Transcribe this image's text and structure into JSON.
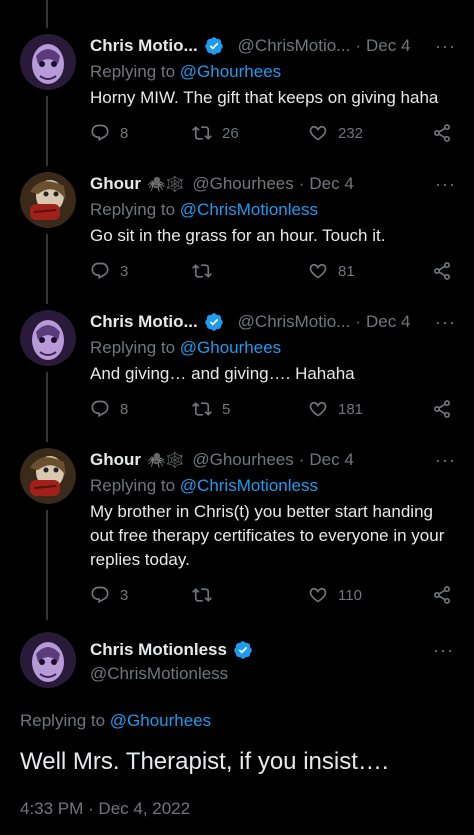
{
  "tweets": [
    {
      "name": "Chris Motio...",
      "handle": "@ChrisMotio...",
      "date": "Dec 4",
      "replying_prefix": "Replying to ",
      "replying_to": "@Ghourhees",
      "text": "Horny MIW. The gift that keeps on giving haha",
      "replies": "8",
      "retweets": "26",
      "likes": "232"
    },
    {
      "name": "Ghour",
      "handle": "@Ghourhees",
      "date": "Dec 4",
      "replying_prefix": "Replying to ",
      "replying_to": "@ChrisMotionless",
      "text": "Go sit in the grass for an hour. Touch it.",
      "replies": "3",
      "retweets": "",
      "likes": "81"
    },
    {
      "name": "Chris Motio...",
      "handle": "@ChrisMotio...",
      "date": "Dec 4",
      "replying_prefix": "Replying to ",
      "replying_to": "@Ghourhees",
      "text": "And giving… and giving…. Hahaha",
      "replies": "8",
      "retweets": "5",
      "likes": "181"
    },
    {
      "name": "Ghour",
      "handle": "@Ghourhees",
      "date": "Dec 4",
      "replying_prefix": "Replying to ",
      "replying_to": "@ChrisMotionless",
      "text": "My brother in Chris(t) you better start handing out free therapy certificates to everyone in your replies today.",
      "replies": "3",
      "retweets": "",
      "likes": "110"
    }
  ],
  "ghour_emojis": "🕷️🕸️",
  "dot_separator": "·",
  "more_glyph": "···",
  "main_tweet": {
    "name": "Chris Motionless",
    "handle": "@ChrisMotionless",
    "replying_prefix": "Replying to ",
    "replying_to": "@Ghourhees",
    "text": "Well Mrs. Therapist, if you insist….",
    "timestamp": "4:33 PM · Dec 4, 2022"
  },
  "colors": {
    "background": "#000000",
    "text": "#e7e9ea",
    "muted": "#71767b",
    "accent": "#1d9bf0"
  }
}
